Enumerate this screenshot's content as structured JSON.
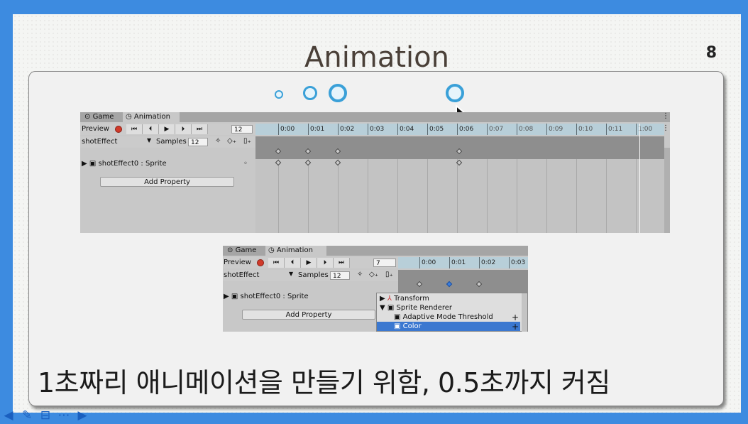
{
  "slide": {
    "title": "Animation",
    "page_number": "8",
    "caption": "1초짜리 애니메이션을 만들기 위함, 0.5초까지 커짐"
  },
  "panel1": {
    "tabs": [
      "Game",
      "Animation"
    ],
    "preview_label": "Preview",
    "frame_value": "12",
    "clip_name": "shotEffect",
    "samples_label": "Samples",
    "samples_value": "12",
    "property_label": "shotEffect0 : Sprite",
    "add_property_label": "Add Property",
    "ruler_ticks": [
      "0:00",
      "0:01",
      "0:02",
      "0:03",
      "0:04",
      "0:05",
      "0:06",
      "0:07",
      "0:08",
      "0:09",
      "0:10",
      "0:11",
      "1:00"
    ]
  },
  "panel2": {
    "tabs": [
      "Game",
      "Animation"
    ],
    "preview_label": "Preview",
    "frame_value": "7",
    "clip_name": "shotEffect",
    "samples_label": "Samples",
    "samples_value": "12",
    "property_label": "shotEffect0 : Sprite",
    "add_property_label": "Add Property",
    "ruler_ticks": [
      "0:00",
      "0:01",
      "0:02",
      "0:03"
    ],
    "dropdown_items": [
      "Transform",
      "Sprite Renderer",
      "Adaptive Mode Threshold",
      "Color"
    ]
  },
  "colors": {
    "background": "#3d8be0",
    "circle": "#3aa0d8",
    "record": "#d03a2a",
    "selection": "#3b78d0"
  },
  "icons": [
    "game-icon",
    "clock-icon",
    "record-icon",
    "first-frame-icon",
    "prev-frame-icon",
    "play-icon",
    "next-frame-icon",
    "last-frame-icon",
    "add-keyframe-icon",
    "add-event-icon",
    "cursor-arrow-icon"
  ]
}
